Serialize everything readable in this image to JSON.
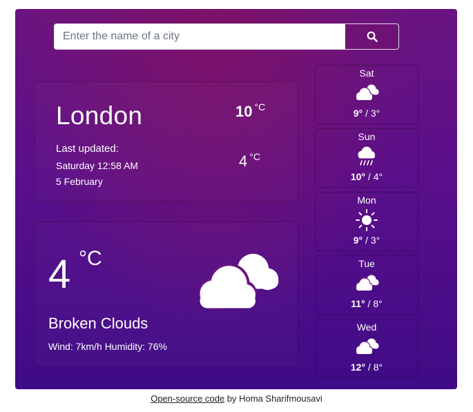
{
  "search": {
    "placeholder": "Enter the name of a city",
    "button_icon": "search-icon"
  },
  "location": {
    "city": "London",
    "last_updated_label": "Last updated:",
    "last_updated_time": "Saturday 12:58 AM",
    "last_updated_date": "5 February",
    "temp_max": "10",
    "temp_min": "4",
    "unit": "°C"
  },
  "current": {
    "temp": "4",
    "unit": "°C",
    "description": "Broken Clouds",
    "details": "Wind: 7km/h Humidity: 76%",
    "icon": "broken-clouds-icon"
  },
  "forecast": [
    {
      "day": "Sat",
      "icon": "broken-clouds-icon",
      "max": "9°",
      "min": "3°"
    },
    {
      "day": "Sun",
      "icon": "rain-icon",
      "max": "10°",
      "min": "4°"
    },
    {
      "day": "Mon",
      "icon": "sun-icon",
      "max": "9°",
      "min": "3°"
    },
    {
      "day": "Tue",
      "icon": "broken-clouds-icon",
      "max": "11°",
      "min": "8°"
    },
    {
      "day": "Wed",
      "icon": "broken-clouds-icon",
      "max": "12°",
      "min": "8°"
    }
  ],
  "footer": {
    "link_text": "Open-source code",
    "suffix": " by Homa Sharifmousavi"
  },
  "colors": {
    "accent": "#6f1276",
    "background_top": "#7d1268",
    "background_bottom": "#3f0b86"
  }
}
